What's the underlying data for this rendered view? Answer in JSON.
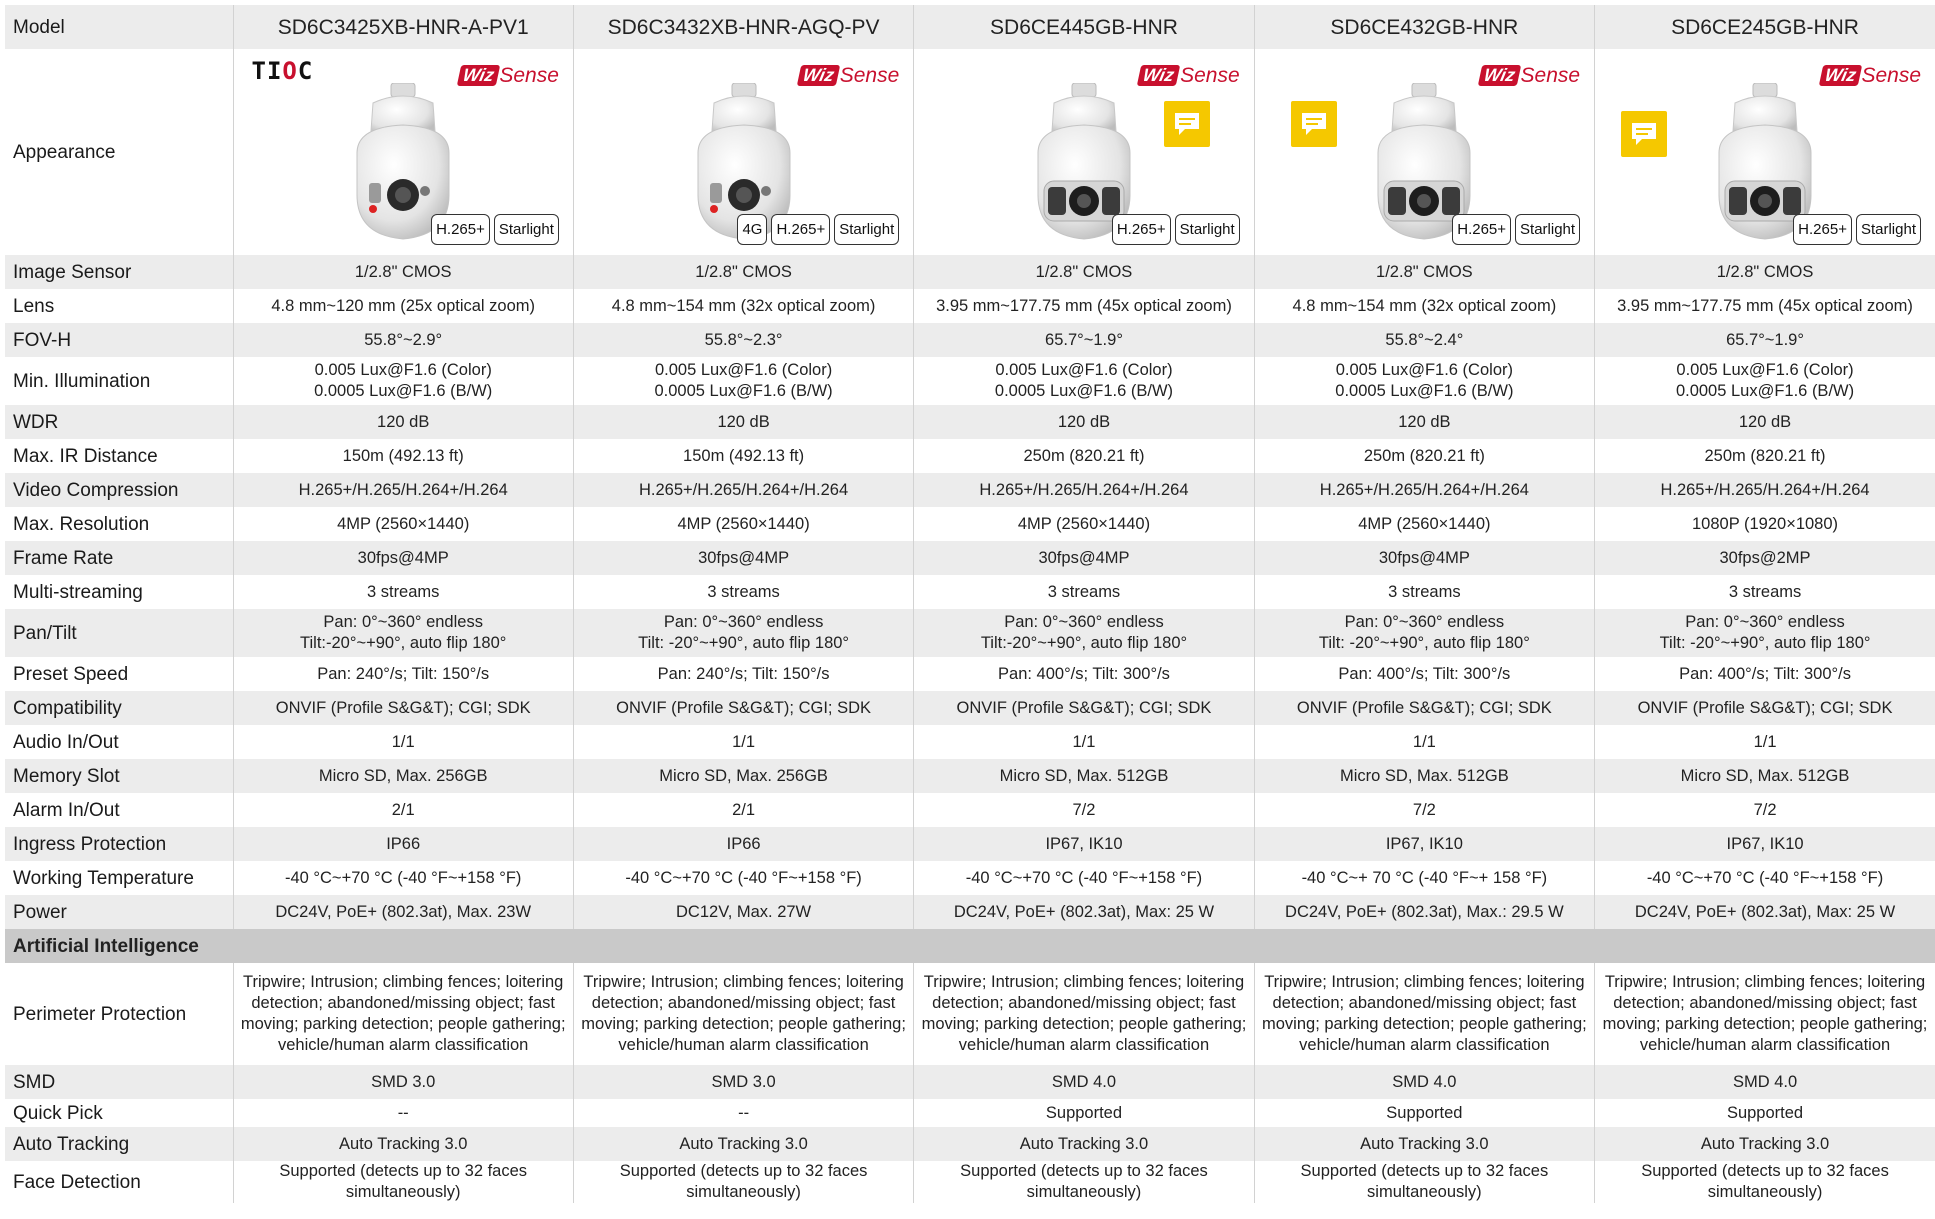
{
  "header": {
    "label": "Model",
    "models": [
      "SD6C3425XB-HNR-A-PV1",
      "SD6C3432XB-HNR-AGQ-PV",
      "SD6CE445GB-HNR",
      "SD6CE432GB-HNR",
      "SD6CE245GB-HNR"
    ]
  },
  "appearance": {
    "label": "Appearance",
    "logo_text": "TIOC",
    "wiz_text": "Wiz",
    "sense_text": "Sense",
    "badges": [
      [
        "H.265+",
        "Starlight"
      ],
      [
        "4G",
        "H.265+",
        "Starlight"
      ],
      [
        "H.265+",
        "Starlight"
      ],
      [
        "H.265+",
        "Starlight"
      ],
      [
        "H.265+",
        "Starlight"
      ]
    ]
  },
  "rows": [
    {
      "label": "Image Sensor",
      "values": [
        "1/2.8\" CMOS",
        "1/2.8\" CMOS",
        "1/2.8\" CMOS",
        "1/2.8\" CMOS",
        "1/2.8\" CMOS"
      ]
    },
    {
      "label": "Lens",
      "values": [
        "4.8 mm~120 mm (25x optical zoom)",
        "4.8 mm~154 mm (32x optical zoom)",
        "3.95 mm~177.75 mm (45x optical zoom)",
        "4.8 mm~154 mm (32x optical zoom)",
        "3.95 mm~177.75 mm (45x optical zoom)"
      ]
    },
    {
      "label": "FOV-H",
      "values": [
        "55.8°~2.9°",
        "55.8°~2.3°",
        "65.7°~1.9°",
        "55.8°~2.4°",
        "65.7°~1.9°"
      ]
    },
    {
      "label": "Min. Illumination",
      "values": [
        [
          "0.005 Lux@F1.6 (Color)",
          "0.0005 Lux@F1.6 (B/W)"
        ],
        [
          "0.005 Lux@F1.6 (Color)",
          "0.0005 Lux@F1.6 (B/W)"
        ],
        [
          "0.005 Lux@F1.6 (Color)",
          "0.0005 Lux@F1.6 (B/W)"
        ],
        [
          "0.005 Lux@F1.6 (Color)",
          "0.0005 Lux@F1.6 (B/W)"
        ],
        [
          "0.005 Lux@F1.6 (Color)",
          "0.0005 Lux@F1.6 (B/W)"
        ]
      ]
    },
    {
      "label": "WDR",
      "values": [
        "120 dB",
        "120 dB",
        "120 dB",
        "120 dB",
        "120 dB"
      ]
    },
    {
      "label": "Max. IR Distance",
      "values": [
        "150m (492.13 ft)",
        "150m (492.13 ft)",
        "250m (820.21 ft)",
        "250m (820.21 ft)",
        "250m (820.21 ft)"
      ]
    },
    {
      "label": "Video Compression",
      "values": [
        "H.265+/H.265/H.264+/H.264",
        "H.265+/H.265/H.264+/H.264",
        "H.265+/H.265/H.264+/H.264",
        "H.265+/H.265/H.264+/H.264",
        "H.265+/H.265/H.264+/H.264"
      ]
    },
    {
      "label": "Max. Resolution",
      "values": [
        "4MP (2560×1440)",
        "4MP (2560×1440)",
        "4MP (2560×1440)",
        "4MP (2560×1440)",
        "1080P (1920×1080)"
      ]
    },
    {
      "label": "Frame Rate",
      "values": [
        "30fps@4MP",
        "30fps@4MP",
        "30fps@4MP",
        "30fps@4MP",
        "30fps@2MP"
      ]
    },
    {
      "label": "Multi-streaming",
      "values": [
        "3 streams",
        "3 streams",
        "3 streams",
        "3 streams",
        "3 streams"
      ]
    },
    {
      "label": "Pan/Tilt",
      "values": [
        [
          "Pan: 0°~360° endless",
          "Tilt:-20°~+90°, auto flip 180°"
        ],
        [
          "Pan: 0°~360° endless",
          "Tilt: -20°~+90°, auto flip 180°"
        ],
        [
          "Pan: 0°~360° endless",
          "Tilt:-20°~+90°, auto flip 180°"
        ],
        [
          "Pan: 0°~360° endless",
          "Tilt: -20°~+90°, auto flip 180°"
        ],
        [
          "Pan: 0°~360° endless",
          "Tilt: -20°~+90°, auto flip 180°"
        ]
      ]
    },
    {
      "label": "Preset Speed",
      "values": [
        "Pan: 240°/s; Tilt: 150°/s",
        "Pan: 240°/s; Tilt: 150°/s",
        "Pan: 400°/s; Tilt: 300°/s",
        "Pan: 400°/s; Tilt: 300°/s",
        "Pan: 400°/s; Tilt: 300°/s"
      ]
    },
    {
      "label": "Compatibility",
      "values": [
        "ONVIF (Profile S&G&T); CGI; SDK",
        "ONVIF (Profile S&G&T); CGI; SDK",
        "ONVIF (Profile S&G&T); CGI; SDK",
        "ONVIF (Profile S&G&T); CGI; SDK",
        "ONVIF (Profile S&G&T); CGI; SDK"
      ]
    },
    {
      "label": "Audio In/Out",
      "values": [
        "1/1",
        "1/1",
        "1/1",
        "1/1",
        "1/1"
      ]
    },
    {
      "label": "Memory Slot",
      "values": [
        "Micro SD, Max. 256GB",
        "Micro SD, Max. 256GB",
        "Micro SD, Max. 512GB",
        "Micro SD, Max. 512GB",
        "Micro SD, Max. 512GB"
      ]
    },
    {
      "label": "Alarm In/Out",
      "values": [
        "2/1",
        "2/1",
        "7/2",
        "7/2",
        "7/2"
      ]
    },
    {
      "label": "Ingress Protection",
      "values": [
        "IP66",
        "IP66",
        "IP67, IK10",
        "IP67, IK10",
        "IP67, IK10"
      ]
    },
    {
      "label": "Working Temperature",
      "values": [
        "-40 °C~+70 °C (-40 °F~+158 °F)",
        "-40 °C~+70 °C (-40 °F~+158 °F)",
        "-40 °C~+70 °C (-40 °F~+158 °F)",
        "-40 °C~+ 70 °C (-40 °F~+ 158 °F)",
        "-40 °C~+70 °C (-40 °F~+158 °F)"
      ]
    },
    {
      "label": "Power",
      "values": [
        "DC24V, PoE+ (802.3at), Max. 23W",
        "DC12V, Max. 27W",
        "DC24V, PoE+ (802.3at), Max: 25 W",
        "DC24V, PoE+ (802.3at), Max.: 29.5 W",
        "DC24V, PoE+ (802.3at), Max: 25 W"
      ]
    }
  ],
  "section_ai": {
    "label": "Artificial Intelligence"
  },
  "ai_rows": [
    {
      "label": "Perimeter Protection",
      "values": [
        "Tripwire; Intrusion; climbing fences; loitering detection; abandoned/missing object; fast moving; parking detection; people gathering; vehicle/human alarm classification",
        "Tripwire; Intrusion; climbing fences; loitering detection; abandoned/missing object; fast moving; parking detection; people gathering; vehicle/human alarm classification",
        "Tripwire; Intrusion; climbing fences; loitering detection; abandoned/missing object; fast moving; parking detection; people gathering; vehicle/human alarm classification",
        "Tripwire; Intrusion; climbing fences; loitering detection; abandoned/missing object; fast moving; parking detection; people gathering; vehicle/human alarm classification",
        "Tripwire; Intrusion; climbing fences; loitering detection; abandoned/missing object; fast moving; parking detection; people gathering; vehicle/human alarm classification"
      ]
    },
    {
      "label": "SMD",
      "values": [
        "SMD 3.0",
        "SMD 3.0",
        "SMD 4.0",
        "SMD 4.0",
        "SMD 4.0"
      ]
    },
    {
      "label": "Quick Pick",
      "values": [
        "--",
        "--",
        "Supported",
        "Supported",
        "Supported"
      ]
    },
    {
      "label": "Auto Tracking",
      "values": [
        "Auto Tracking 3.0",
        "Auto Tracking 3.0",
        "Auto Tracking 3.0",
        "Auto Tracking 3.0",
        "Auto Tracking 3.0"
      ]
    },
    {
      "label": "Face Detection",
      "values": [
        "Supported (detects up to 32 faces simultaneously)",
        "Supported (detects up to 32 faces simultaneously)",
        "Supported (detects up to 32 faces simultaneously)",
        "Supported (detects up to 32 faces simultaneously)",
        "Supported (detects up to 32 faces simultaneously)"
      ]
    }
  ],
  "colors": {
    "wiz_red": "#c8102e",
    "note_yellow": "#f5c800",
    "row_grey": "#ececec",
    "section_grey": "#c9c9c9"
  },
  "icons": {
    "comment": "comment-icon"
  }
}
